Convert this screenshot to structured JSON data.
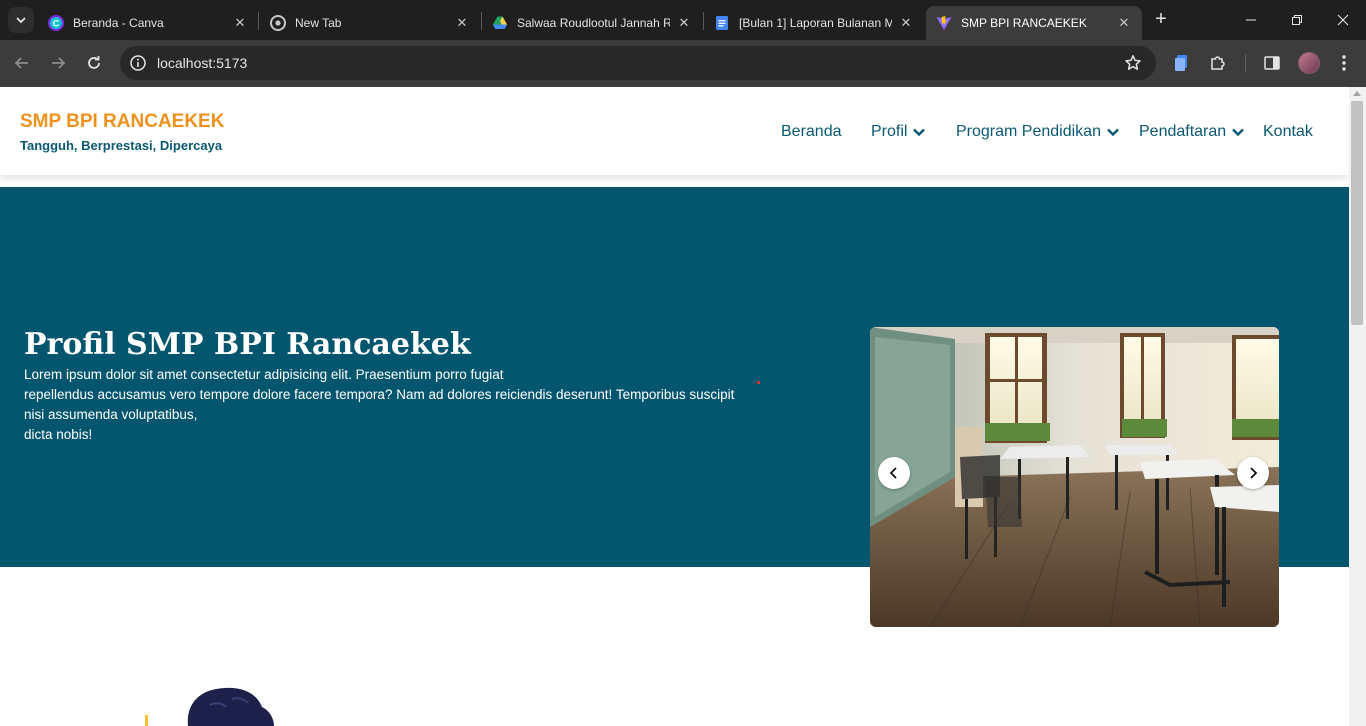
{
  "browser": {
    "tabs": [
      {
        "title": "Beranda - Canva",
        "icon": "canva-icon"
      },
      {
        "title": "New Tab",
        "icon": "chrome-icon"
      },
      {
        "title": "Salwaa Roudlootul Jannah R",
        "icon": "google-drive-icon"
      },
      {
        "title": "[Bulan 1] Laporan Bulanan M",
        "icon": "google-docs-icon"
      },
      {
        "title": "SMP BPI RANCAEKEK",
        "icon": "vite-icon",
        "active": true
      }
    ],
    "url": "localhost:5173"
  },
  "site": {
    "brand": "SMP BPI RANCAEKEK",
    "tagline": "Tangguh, Berprestasi, Dipercaya",
    "nav": [
      {
        "label": "Beranda",
        "dropdown": false
      },
      {
        "label": "Profil",
        "dropdown": true
      },
      {
        "label": "Program Pendidikan",
        "dropdown": true
      },
      {
        "label": "Pendaftaran",
        "dropdown": true
      },
      {
        "label": "Kontak",
        "dropdown": false
      }
    ],
    "colors": {
      "brand": "#ee921d",
      "primary": "#04566f",
      "nav_text": "#0a5970"
    }
  },
  "hero": {
    "title": "Profil SMP BPI Rancaekek",
    "paragraph_lines": [
      "Lorem ipsum dolor sit amet consectetur adipisicing elit. Praesentium porro fugiat",
      "repellendus accusamus vero tempore dolore facere tempora? Nam ad dolores reiciendis deserunt! Temporibus suscipit",
      "nisi assumenda voluptatibus,",
      "dicta nobis!"
    ],
    "carousel": {
      "prev_icon": "chevron-left-icon",
      "next_icon": "chevron-right-icon"
    }
  }
}
